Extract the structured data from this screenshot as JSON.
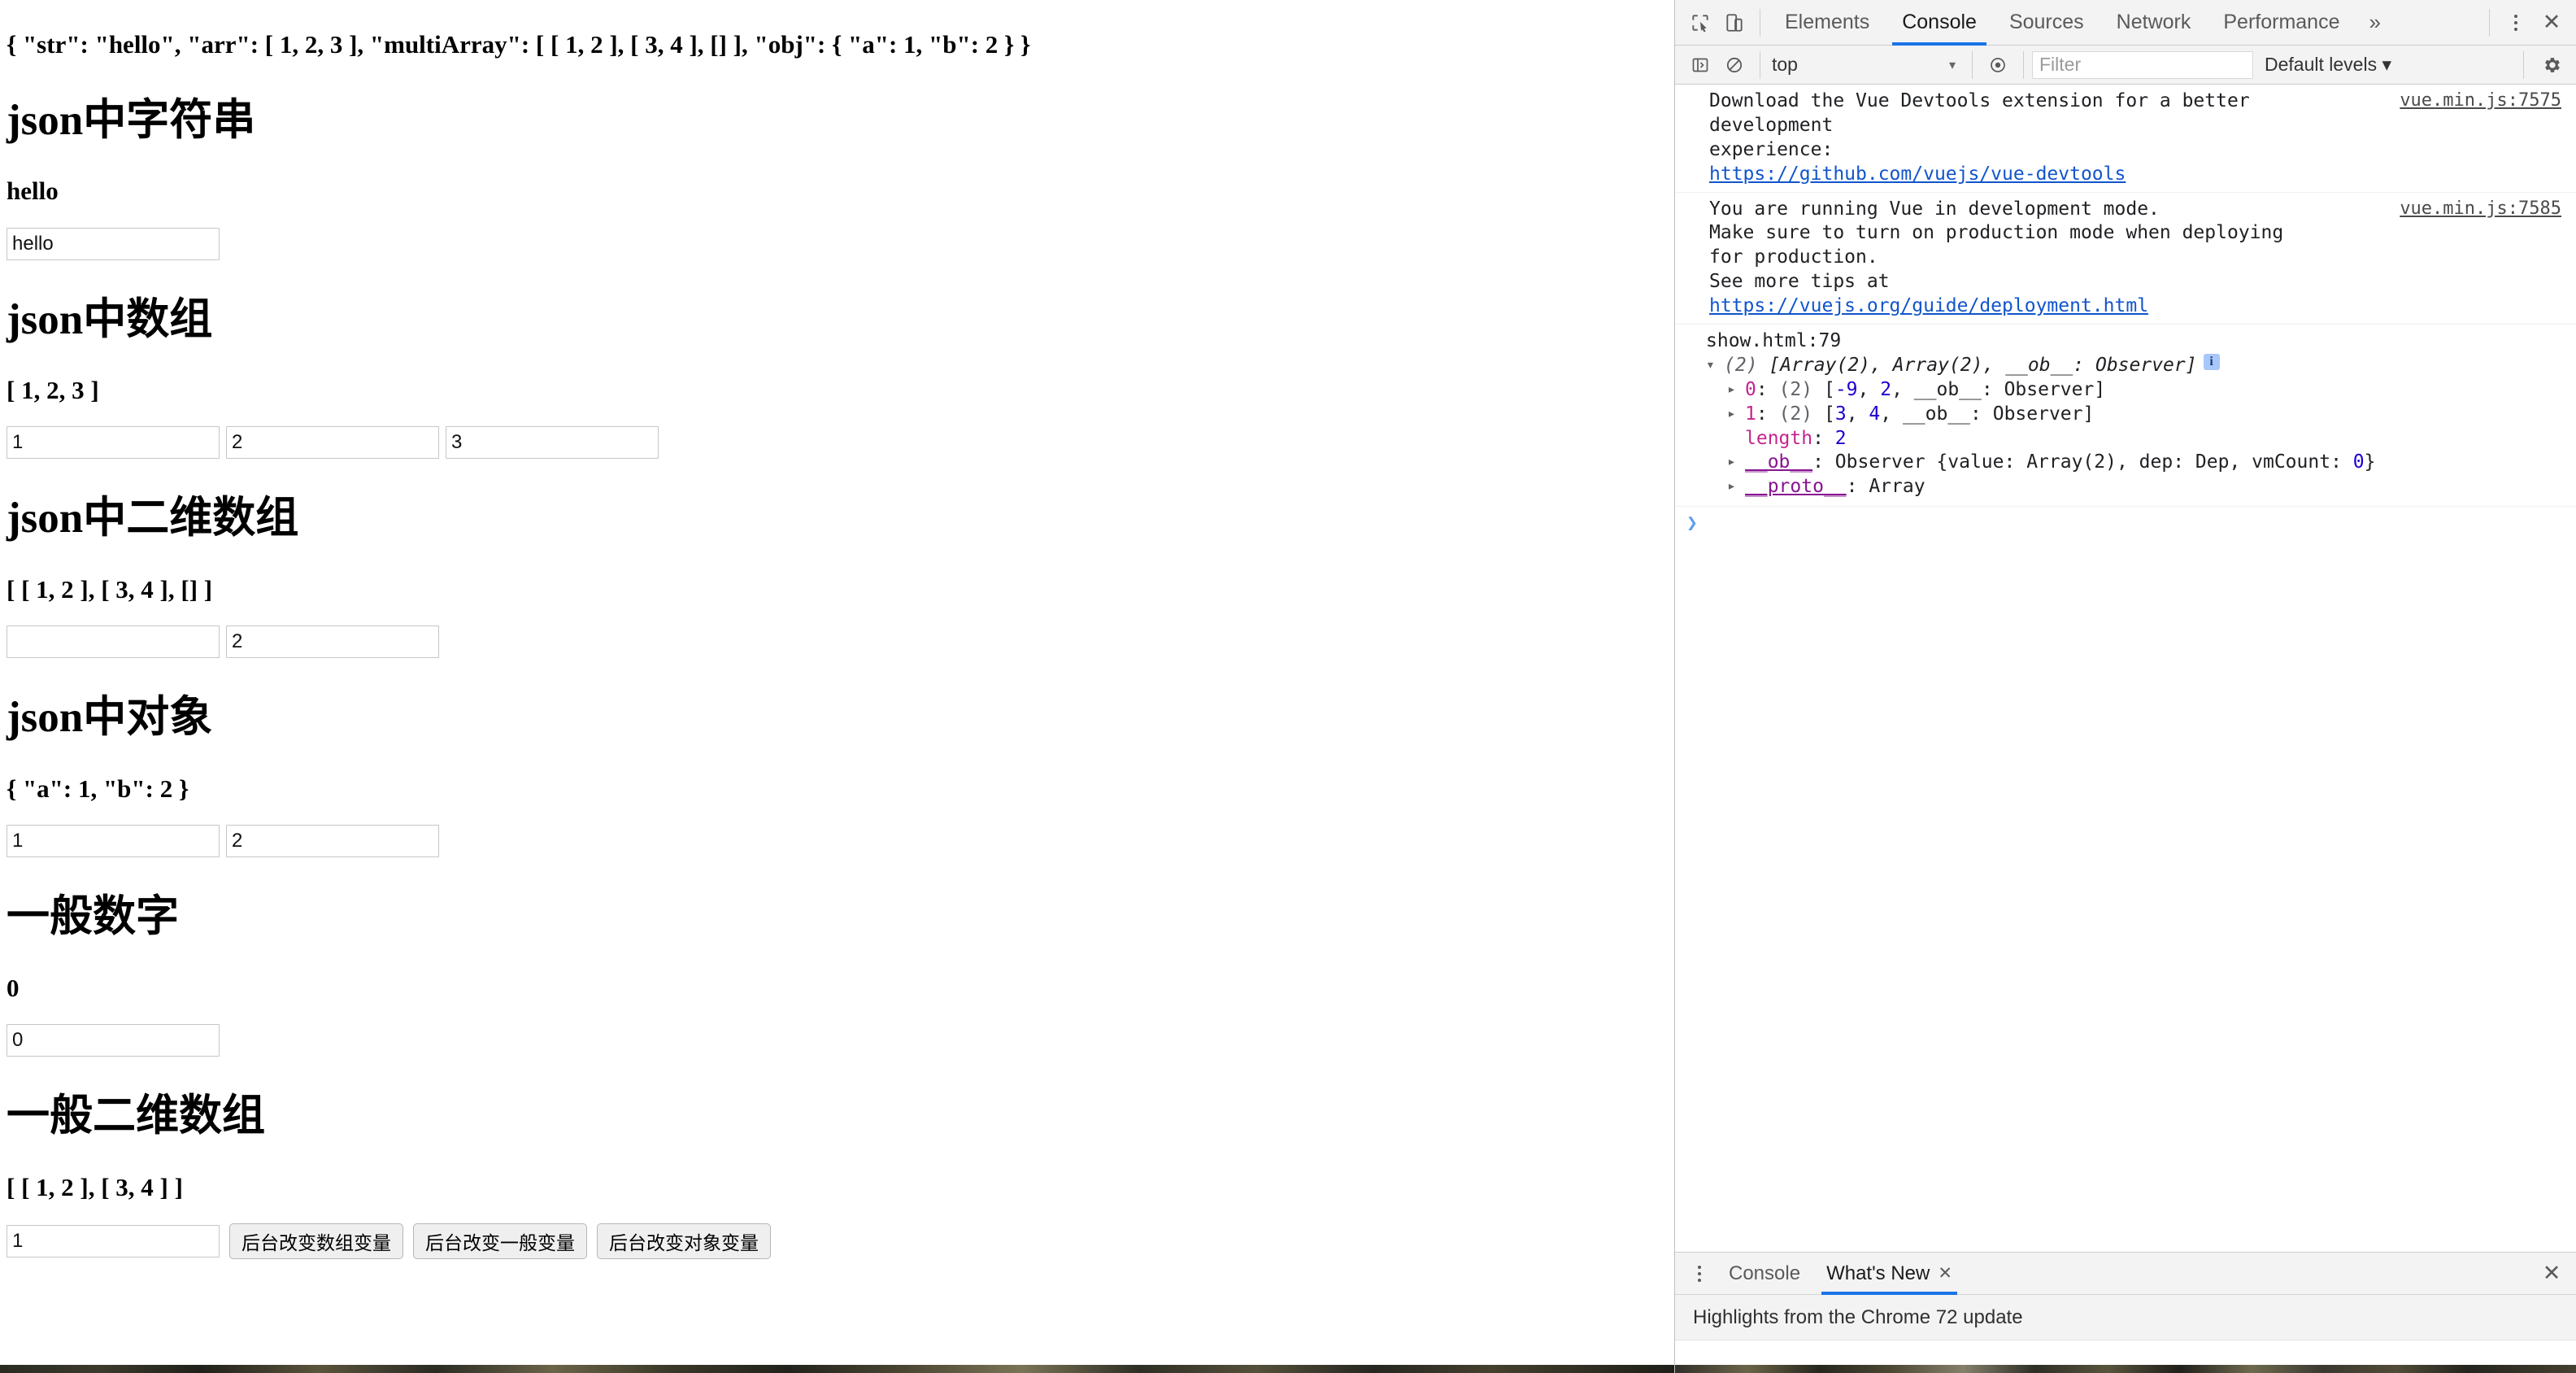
{
  "page": {
    "json_line": "{ \"str\": \"hello\", \"arr\": [ 1, 2, 3 ], \"multiArray\": [ [ 1, 2 ], [ 3, 4 ], [] ], \"obj\": { \"a\": 1, \"b\": 2 } }",
    "sections": [
      {
        "title": "json中字符串",
        "value": "hello",
        "inputs": [
          "hello"
        ]
      },
      {
        "title": "json中数组",
        "value": "[ 1, 2, 3 ]",
        "inputs": [
          "1",
          "2",
          "3"
        ]
      },
      {
        "title": "json中二维数组",
        "value": "[ [ 1, 2 ], [ 3, 4 ], [] ]",
        "inputs": [
          "",
          "2"
        ]
      },
      {
        "title": "json中对象",
        "value": "{ \"a\": 1, \"b\": 2 }",
        "inputs": [
          "1",
          "2"
        ]
      },
      {
        "title": "一般数字",
        "value": "0",
        "inputs": [
          "0"
        ]
      },
      {
        "title": "一般二维数组",
        "value": "[ [ 1, 2 ], [ 3, 4 ] ]",
        "inputs": [
          "1"
        ]
      }
    ],
    "buttons": [
      "后台改变数组变量",
      "后台改变一般变量",
      "后台改变对象变量"
    ]
  },
  "devtools": {
    "tabs": [
      {
        "label": "Elements",
        "active": false
      },
      {
        "label": "Console",
        "active": true
      },
      {
        "label": "Sources",
        "active": false
      },
      {
        "label": "Network",
        "active": false
      },
      {
        "label": "Performance",
        "active": false
      }
    ],
    "more_tabs_label": "»",
    "close_label": "✕",
    "icons": {
      "inspect": "inspect-element-icon",
      "device": "device-toolbar-icon",
      "sidebar": "console-sidebar-icon",
      "clear": "clear-console-icon",
      "eye": "live-expression-icon",
      "gear": "settings-gear-icon"
    },
    "filterbar": {
      "context": "top",
      "context_caret": "▾",
      "filter_placeholder": "Filter",
      "filter_value": "",
      "levels": "Default levels ▾"
    },
    "messages": [
      {
        "kind": "warning-text",
        "line1": "Download the Vue Devtools extension for a better development",
        "line2": "experience:",
        "link": "https://github.com/vuejs/vue-devtools",
        "source": "vue.min.js:7575"
      },
      {
        "kind": "warning-text",
        "line1": "You are running Vue in development mode.",
        "line2": "Make sure to turn on production mode when deploying for production.",
        "line3_prefix": "See more tips at ",
        "link": "https://vuejs.org/guide/deployment.html",
        "source": "vue.min.js:7585"
      }
    ],
    "object_log": {
      "source": "show.html:79",
      "header": {
        "arrow": "▾",
        "count": "(2)",
        "preview": "[Array(2), Array(2), __ob__: Observer]",
        "info_badge": "i"
      },
      "children": [
        {
          "arrow": "▸",
          "key": "0",
          "count": "(2)",
          "open": "[",
          "values": [
            "-9",
            "2"
          ],
          "tail": ", __ob__: Observer]"
        },
        {
          "arrow": "▸",
          "key": "1",
          "count": "(2)",
          "open": "[",
          "values": [
            "3",
            "4"
          ],
          "tail": ", __ob__: Observer]"
        },
        {
          "arrow": "",
          "key": "length",
          "value": "2"
        },
        {
          "arrow": "▸",
          "key": "__ob__",
          "value_prefix": "Observer {value: Array(2), dep: Dep, vmCount: ",
          "value_num": "0",
          "value_suffix": "}"
        },
        {
          "arrow": "▸",
          "key": "__proto__",
          "value": "Array"
        }
      ]
    },
    "prompt": {
      "chevron": "❯"
    },
    "drawer": {
      "tabs": [
        {
          "label": "Console",
          "active": false,
          "closable": false
        },
        {
          "label": "What's New",
          "active": true,
          "closable": true,
          "close": "✕"
        }
      ],
      "close_label": "✕",
      "content": "Highlights from the Chrome 72 update"
    }
  },
  "colors": {
    "accent": "#1a73e8",
    "link": "#1155cc",
    "toolbar_bg": "#f3f3f3",
    "prop_pink": "#c5248f",
    "num_blue": "#1c00cf",
    "name_purple": "#881391",
    "gray_text": "#5f6368"
  }
}
